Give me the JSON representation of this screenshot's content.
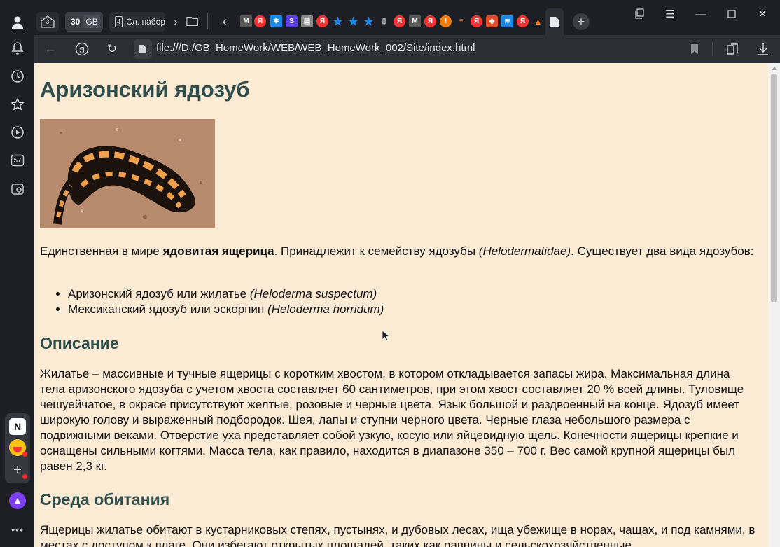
{
  "browser": {
    "tab_groups": [
      {
        "count": "3",
        "label": ""
      },
      {
        "count": "30",
        "label": "GB"
      },
      {
        "count": "4",
        "label": "Сл. набор"
      }
    ],
    "sidebar_badge": "57",
    "url": "file:///D:/GB_HomeWork/WEB/WEB_HomeWork_002/Site/index.html",
    "accent_color": "#2f4f4f",
    "page_background": "#fcebd4"
  },
  "page": {
    "title": "Аризонский ядозуб",
    "photo_alt": "Аризонский ядозуб",
    "intro_prefix": "Единственная в мире ",
    "intro_bold": "ядовитая ящерица",
    "intro_middle": ". Принадлежит к семейству ядозубы ",
    "intro_italic": "(Helodermatidae)",
    "intro_suffix": ". Существует два вида ядозубов:",
    "species": [
      {
        "name": "Аризонский ядозуб или жилатье ",
        "latin": "(Heloderma suspectum)"
      },
      {
        "name": "Мексиканский ядозуб или эскорпин ",
        "latin": "(Heloderma horridum)"
      }
    ],
    "description_heading": "Описание",
    "description_text": "Жилатье – массивные и тучные ящерицы с коротким хвостом, в котором откладывается запасы жира. Максимальная длина тела аризонского ядозуба с учетом хвоста составляет 60 сантиметров, при этом хвост составляет 20 % всей длины. Туловище чешуейчатое, в окрасе присутствуют желтые, розовые и черные цвета. Язык большой и раздвоенный на конце. Ядозуб имеет широкую голову и выраженный подбородок. Шея, лапы и ступни черного цвета. Черные глаза небольшого размера с подвижными веками. Отверстие уха представляет собой узкую, косую или яйцевидную щель. Конечности ящерицы крепкие и оснащены сильными когтями. Масса тела, как правило, находится в диапазоне 350 – 700 г. Вес самой крупной ящерицы был равен 2,3 кг.",
    "habitat_heading": "Среда обитания",
    "habitat_text": "Ящерицы жилатье обитают в кустарниковых степях, пустынях, и дубовых лесах, ища убежище в норах, чащах, и под камнями, в местах с доступом к влаге. Они избегают открытых площадей, таких как равнины и сельскохозяйственные"
  }
}
